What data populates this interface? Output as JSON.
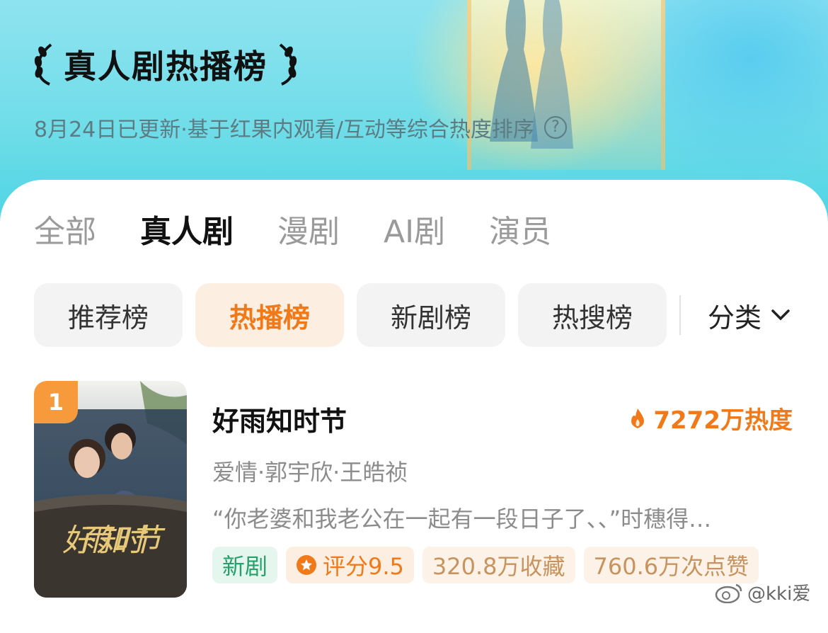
{
  "header": {
    "title": "真人剧热播榜",
    "subtitle": "8月24日已更新·基于红果内观看/互动等综合热度排序"
  },
  "tabs": [
    {
      "label": "全部"
    },
    {
      "label": "真人剧",
      "active": true
    },
    {
      "label": "漫剧"
    },
    {
      "label": "AI剧"
    },
    {
      "label": "演员"
    }
  ],
  "filters": [
    {
      "label": "推荐榜"
    },
    {
      "label": "热播榜",
      "active": true
    },
    {
      "label": "新剧榜"
    },
    {
      "label": "热搜榜"
    }
  ],
  "category": {
    "label": "分类"
  },
  "list": [
    {
      "rank": "1",
      "title": "好雨知时节",
      "heat": "7272万热度",
      "meta": "爱情·郭宇欣·王皓祯",
      "quote": "“你老婆和我老公在一起有一段日子了、、”时穗得…",
      "poster_text": "好雨知时节",
      "tags": {
        "new": "新剧",
        "score": "评分9.5",
        "favorites": "320.8万收藏",
        "likes": "760.6万次点赞"
      }
    }
  ],
  "watermark": "@kki爱",
  "colors": {
    "accent": "#f07a1a",
    "new_tag": "#27a06b",
    "hero": "#6fdde8"
  }
}
